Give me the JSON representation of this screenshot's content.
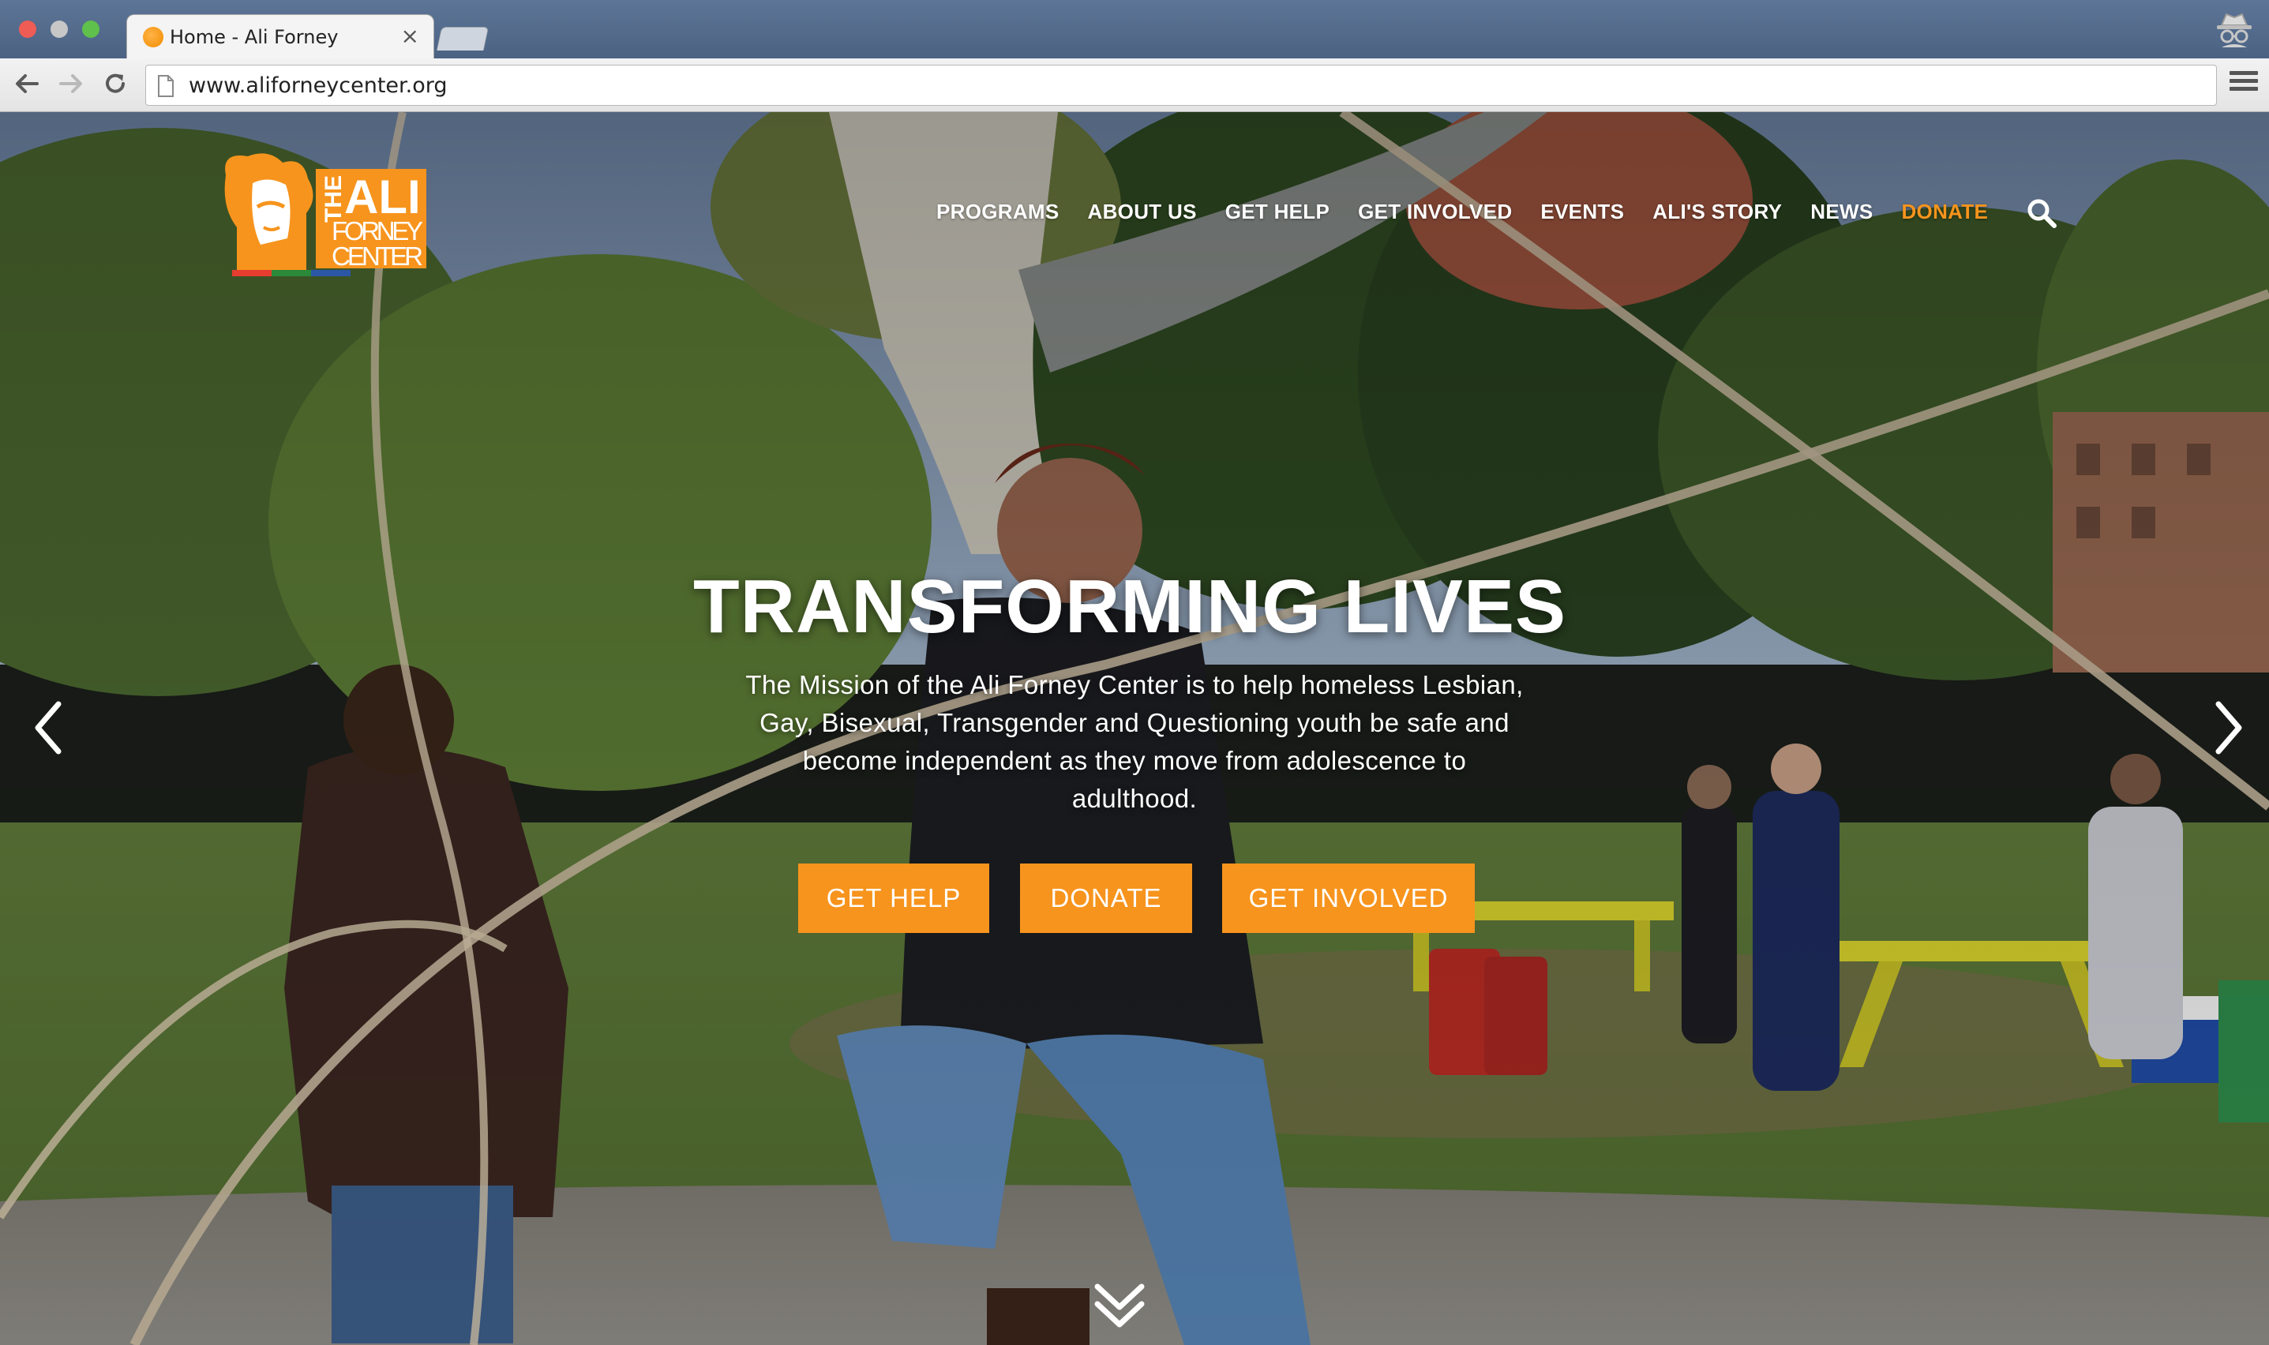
{
  "browser": {
    "tab_title": "Home - Ali Forney",
    "tab_close": "×",
    "url": "www.aliforneycenter.org"
  },
  "logo": {
    "line1": "THE",
    "line2": "ALI",
    "line3": "FORNEY",
    "line4": "CENTER",
    "color": "#f7941d"
  },
  "nav": {
    "items": [
      "PROGRAMS",
      "ABOUT US",
      "GET HELP",
      "GET INVOLVED",
      "EVENTS",
      "ALI'S STORY",
      "NEWS",
      "DONATE"
    ],
    "search_icon": "search-icon"
  },
  "hero": {
    "title": "TRANSFORMING LIVES",
    "mission": "The Mission of the Ali Forney Center is to help homeless Lesbian, Gay, Bisexual, Transgender and Questioning youth be safe and become independent as they move from adolescence to adulthood.",
    "buttons": {
      "get_help": "GET HELP",
      "donate": "DONATE",
      "get_involved": "GET INVOLVED"
    }
  },
  "colors": {
    "accent": "#f7941d",
    "chrome_tabstrip": "#566e90",
    "text_white": "#ffffff"
  }
}
